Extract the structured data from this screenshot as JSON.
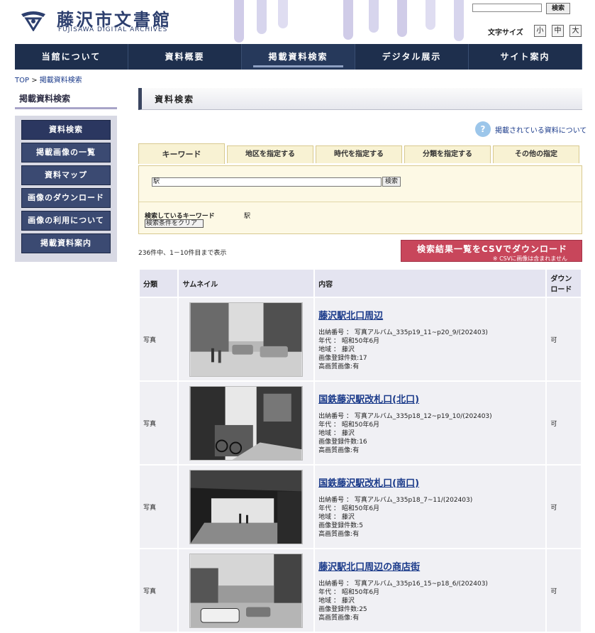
{
  "header": {
    "logo_title": "藤沢市文書館",
    "logo_subtitle": "FUJISAWA DIGITAL ARCHIVES",
    "search_button": "検索",
    "font_size_label": "文字サイズ",
    "font_sizes": [
      "小",
      "中",
      "大"
    ]
  },
  "nav": [
    "当館について",
    "資料概要",
    "掲載資料検索",
    "デジタル展示",
    "サイト案内"
  ],
  "breadcrumb": {
    "top": "TOP",
    "sep": ">",
    "current": "掲載資料検索"
  },
  "sidebar": {
    "title": "掲載資料検索",
    "items": [
      "資料検索",
      "掲載画像の一覧",
      "資料マップ",
      "画像のダウンロード",
      "画像の利用について",
      "掲載資料案内"
    ]
  },
  "main": {
    "title": "資料検索",
    "help_link": "掲載されている資料について",
    "tabs": [
      "キーワード",
      "地区を指定する",
      "時代を指定する",
      "分類を指定する",
      "その他の指定"
    ],
    "keyword_value": "駅",
    "keyword_button": "検索",
    "searching_label": "検索しているキーワード",
    "searching_value": "駅",
    "clear_button": "検索条件をクリア",
    "result_count": "236件中、1－10件目まで表示",
    "csv_button": "検索結果一覧をCSVでダウンロード",
    "csv_note": "※ CSVに画像は含まれません"
  },
  "table": {
    "headers": [
      "分類",
      "サムネイル",
      "内容",
      "ダウンロード"
    ],
    "rows": [
      {
        "category": "写真",
        "title": "藤沢駅北口周辺",
        "storage": "出納番号 ： 写真アルバム_335p19_11~p20_9/(202403)",
        "era": "年代 ： 昭和50年6月",
        "area": "地域 ： 藤沢",
        "count": "画像登録件数:17",
        "hq": "高画質画像:有",
        "download": "可",
        "thumb_icon": "station-street-photo"
      },
      {
        "category": "写真",
        "title": "国鉄藤沢駅改札口(北口)",
        "storage": "出納番号 ： 写真アルバム_335p18_12~p19_10/(202403)",
        "era": "年代 ： 昭和50年6月",
        "area": "地域 ： 藤沢",
        "count": "画像登録件数:16",
        "hq": "高画質画像:有",
        "download": "可",
        "thumb_icon": "bicycles-photo"
      },
      {
        "category": "写真",
        "title": "国鉄藤沢駅改札口(南口)",
        "storage": "出納番号 ： 写真アルバム_335p18_7~11/(202403)",
        "era": "年代 ： 昭和50年6月",
        "area": "地域 ： 藤沢",
        "count": "画像登録件数:5",
        "hq": "高画質画像:有",
        "download": "可",
        "thumb_icon": "concourse-photo"
      },
      {
        "category": "写真",
        "title": "藤沢駅北口周辺の商店街",
        "storage": "出納番号 ： 写真アルバム_335p16_15~p18_6/(202403)",
        "era": "年代 ： 昭和50年6月",
        "area": "地域 ： 藤沢",
        "count": "画像登録件数:25",
        "hq": "高画質画像:有",
        "download": "可",
        "thumb_icon": "shopping-street-photo"
      }
    ]
  }
}
